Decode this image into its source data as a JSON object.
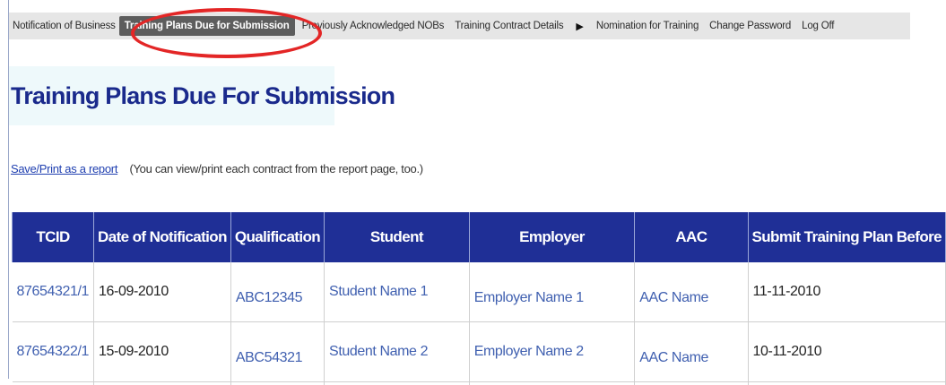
{
  "nav": {
    "items": [
      {
        "label": "Notification of Business"
      },
      {
        "label": "Training Plans Due for Submission"
      },
      {
        "label": "Previously Acknowledged NOBs"
      },
      {
        "label": "Training Contract Details"
      },
      {
        "label": "Nomination for Training"
      },
      {
        "label": "Change Password"
      },
      {
        "label": "Log Off"
      }
    ],
    "arrow_icon": "triangle-right-icon",
    "active": "Training Plans Due for Submission",
    "highlight_color": "#e32626"
  },
  "page": {
    "title": "Training Plans Due For Submission"
  },
  "report": {
    "link_label": "Save/Print as a report",
    "note": "(You can view/print each contract from the report page, too.)"
  },
  "table": {
    "header_bg": "#1f2f96",
    "columns": [
      "TCID",
      "Date of Notification",
      "Qualification",
      "Student",
      "Employer",
      "AAC",
      "Submit Training Plan Before"
    ],
    "rows": [
      [
        "87654321/1",
        "16-09-2010",
        "ABC12345",
        "Student Name 1",
        "Employer Name 1",
        "AAC Name",
        "11-11-2010"
      ],
      [
        "87654322/1",
        "15-09-2010",
        "ABC54321",
        "Student Name 2",
        "Employer Name 2",
        "AAC Name",
        "10-11-2010"
      ]
    ]
  }
}
